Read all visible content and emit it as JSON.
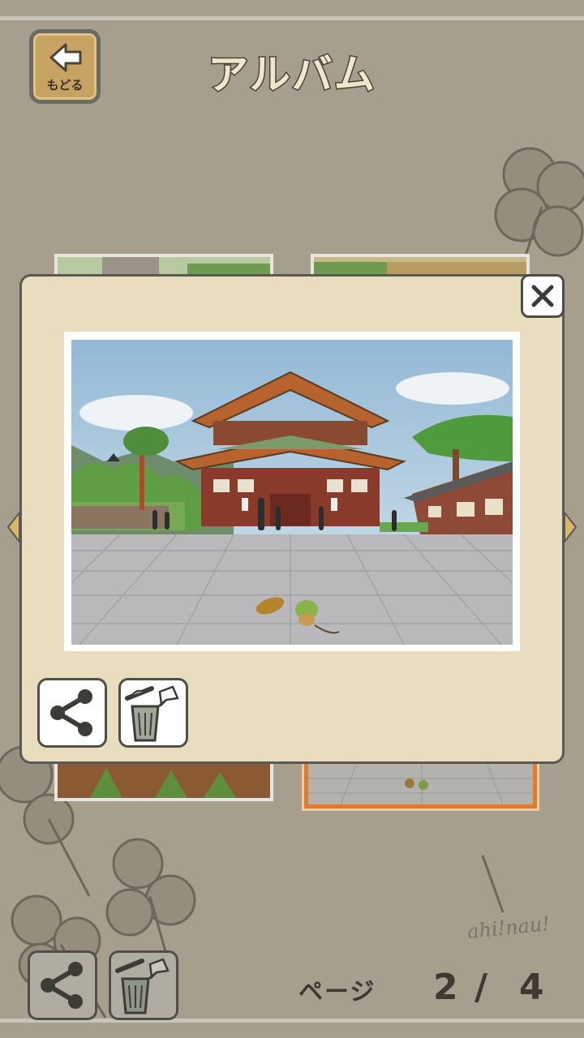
{
  "header": {
    "title": "アルバム",
    "back_label": "もどる"
  },
  "footer": {
    "page_label": "ページ",
    "page_current": "2",
    "page_separator": "/",
    "page_total": "4"
  },
  "decor": {
    "scribble_text": "ahi!nau!"
  },
  "icons": {
    "back": "back-arrow-icon",
    "close": "close-icon",
    "share": "share-icon",
    "delete": "trash-icon"
  },
  "colors": {
    "background": "#a69f8e",
    "popup": "#e8ddbf",
    "selected_border": "#e07a2e",
    "back_button": "#c8a262"
  }
}
